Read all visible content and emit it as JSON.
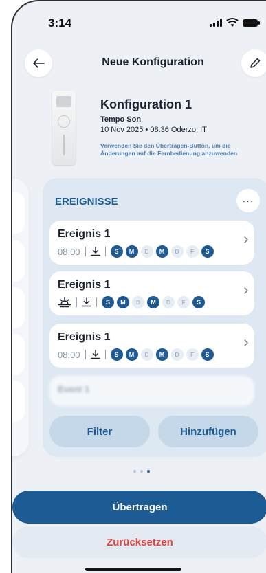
{
  "status_bar": {
    "time": "3:14"
  },
  "header": {
    "title": "Neue Konfiguration",
    "back_icon": "arrow-left-icon",
    "edit_icon": "pencil-icon"
  },
  "config": {
    "title": "Konfiguration 1",
    "device": "Tempo Son",
    "meta": "10 Nov 2025 • 08:36  Oderzo, IT",
    "hint_line1": "Verwenden Sie den Übertragen-Button, um die",
    "hint_line2": "Änderungen auf die Fernbedienung anzuwenden"
  },
  "events_card": {
    "label": "EREIGNISSE",
    "more_label": "···",
    "events": [
      {
        "title": "Ereignis 1",
        "time": "08:00",
        "icon": "download-icon",
        "days": [
          {
            "l": "S",
            "on": true
          },
          {
            "l": "M",
            "on": true
          },
          {
            "l": "D",
            "on": false
          },
          {
            "l": "M",
            "on": true
          },
          {
            "l": "D",
            "on": false
          },
          {
            "l": "F",
            "on": false
          },
          {
            "l": "S",
            "on": true
          }
        ]
      },
      {
        "title": "Ereignis 1",
        "time": "",
        "icon": "sunrise-icon",
        "days": [
          {
            "l": "S",
            "on": true
          },
          {
            "l": "M",
            "on": true
          },
          {
            "l": "D",
            "on": false
          },
          {
            "l": "M",
            "on": true
          },
          {
            "l": "D",
            "on": false
          },
          {
            "l": "F",
            "on": false
          },
          {
            "l": "S",
            "on": true
          }
        ]
      },
      {
        "title": "Ereignis 1",
        "time": "08:00",
        "icon": "download-icon",
        "days": [
          {
            "l": "S",
            "on": true
          },
          {
            "l": "M",
            "on": true
          },
          {
            "l": "D",
            "on": false
          },
          {
            "l": "M",
            "on": true
          },
          {
            "l": "D",
            "on": false
          },
          {
            "l": "F",
            "on": false
          },
          {
            "l": "S",
            "on": true
          }
        ]
      },
      {
        "title": "Event 1",
        "time": "",
        "icon": "",
        "days": []
      }
    ],
    "filter_label": "Filter",
    "add_label": "Hinzufügen"
  },
  "pager": {
    "count": 3,
    "active": 3
  },
  "actions": {
    "transfer_label": "Übertragen",
    "reset_label": "Zurücksetzen"
  },
  "colors": {
    "primary": "#1c5b94",
    "accent_text": "#1b5c96",
    "danger": "#e0413a",
    "background": "#edf1f6"
  }
}
